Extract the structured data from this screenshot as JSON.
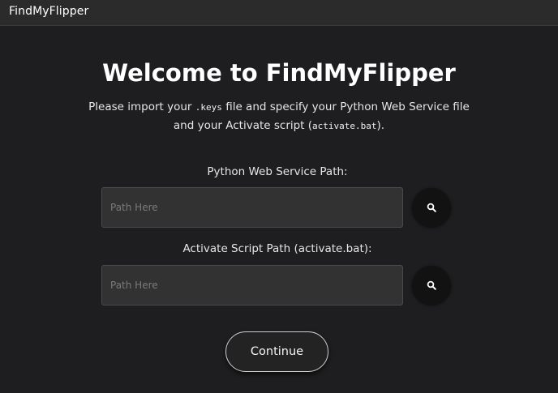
{
  "window": {
    "title": "FindMyFlipper"
  },
  "main": {
    "heading": "Welcome to FindMyFlipper",
    "description": {
      "line1_prefix": "Please import your ",
      "line1_code": ".keys",
      "line1_suffix": " file and specify your Python Web Service file",
      "line2_prefix": "and your Activate script (",
      "line2_code": "activate.bat",
      "line2_suffix": ")."
    },
    "python_field": {
      "label": "Python Web Service Path:",
      "placeholder": "Path Here",
      "value": "",
      "browse_icon": "search-icon"
    },
    "activate_field": {
      "label": "Activate Script Path (activate.bat):",
      "placeholder": "Path Here",
      "value": "",
      "browse_icon": "search-icon"
    },
    "continue_label": "Continue"
  },
  "colors": {
    "background": "#1e1d1f",
    "titlebar": "#2b2b2b",
    "input_background": "#323233",
    "button_dark": "#121212",
    "text": "#ffffff"
  }
}
